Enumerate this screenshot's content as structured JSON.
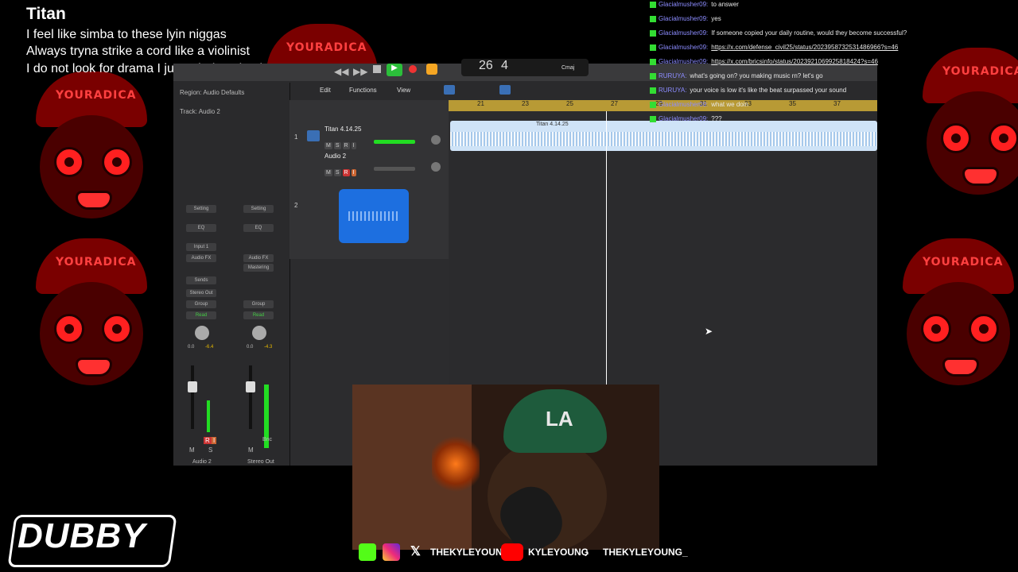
{
  "lyrics": {
    "title": "Titan",
    "lines": [
      "I feel like simba to these lyin niggas",
      "Always tryna strike a cord like a violinist",
      "I do not look for drama I just mind my business"
    ]
  },
  "background": {
    "cap_text": "YOURADICA",
    "accent": "#ff2020"
  },
  "daw": {
    "inspector": {
      "region": "Region: Audio Defaults",
      "track": "Track: Audio 2",
      "setting": "Setting",
      "eq": "EQ",
      "input": "Input 1",
      "audio_fx": "Audio FX",
      "audio_fx_2": "Audio FX",
      "mastering": "Mastering",
      "sends": "Sends",
      "stereo_out": "Stereo Out",
      "group": "Group",
      "read": "Read",
      "vol_left": "0.0",
      "pan_left": "-6.4",
      "vol_right": "0.0",
      "pan_right": "-4.3",
      "channel1": "Audio 2",
      "channel2": "Stereo Out",
      "bnc": "Bnc",
      "m": "M",
      "s": "S",
      "r": "R",
      "i": "I"
    },
    "menus": {
      "edit": "Edit",
      "functions": "Functions",
      "view": "View"
    },
    "lcd": {
      "bar": "26",
      "beat": "4",
      "key": "Cmaj"
    },
    "tracks": [
      {
        "num": "1",
        "name": "Titan 4.14.25"
      },
      {
        "num": "2",
        "name": "Audio 2"
      }
    ],
    "region_name": "Titan 4.14.25",
    "ruler": [
      "21",
      "23",
      "25",
      "27",
      "29",
      "31",
      "33",
      "35",
      "37"
    ],
    "track_buttons": {
      "m": "M",
      "s": "S",
      "r": "R",
      "i": "I"
    }
  },
  "chat": [
    {
      "user": "Glacialmusher09:",
      "msg": "to answer"
    },
    {
      "user": "Glacialmusher09:",
      "msg": "yes"
    },
    {
      "user": "Glacialmusher09:",
      "msg": "If someone copied your daily routine, would they become successful?"
    },
    {
      "user": "Glacialmusher09:",
      "msg": "https://x.com/defense_civil25/status/2023958732531486966?s=46",
      "link": true
    },
    {
      "user": "Glacialmusher09:",
      "msg": "https://x.com/bricsinfo/status/2023921069925818424?s=46",
      "link": true
    },
    {
      "user": "RURUYA:",
      "msg": "what's going on? you making music rn? let's go"
    },
    {
      "user": "RURUYA:",
      "msg": "your voice is low it's like the beat surpassed your sound"
    },
    {
      "user": "Glacialmusher09:",
      "msg": "what we doin"
    },
    {
      "user": "Glacialmusher09:",
      "msg": "???"
    }
  ],
  "socials": {
    "x_handle": "THEKYLEYOUNG",
    "youtube_handle": "KYLEYOUNG",
    "tiktok_handle": "THEKYLEYOUNG_",
    "x_glyph": "𝕏"
  },
  "logo": {
    "text": "DUBBY"
  },
  "colors": {
    "kick_green": "#33dd33",
    "region_blue": "#cfe3f7",
    "ruler_gold": "#b89a35",
    "youtube_red": "#ff0000"
  }
}
